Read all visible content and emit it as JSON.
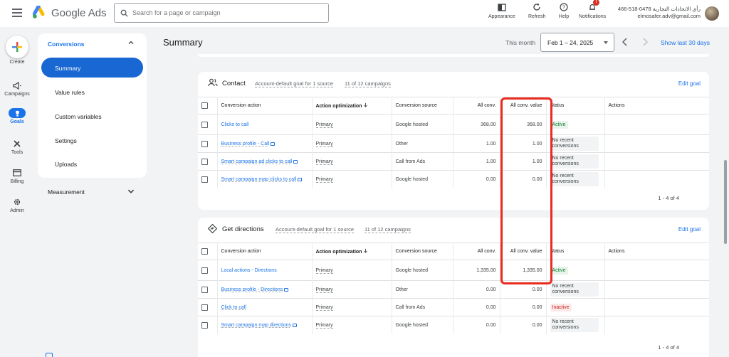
{
  "app": {
    "brand": "Google Ads",
    "search_placeholder": "Search for a page or campaign",
    "actions": [
      {
        "label": "Appearance",
        "icon": "appearance-icon"
      },
      {
        "label": "Refresh",
        "icon": "refresh-icon"
      },
      {
        "label": "Help",
        "icon": "help-icon"
      },
      {
        "label": "Notifications",
        "icon": "bell-icon",
        "badge": "!"
      }
    ],
    "account": {
      "name": "466-518-0478 رأي الاتحادات التجارية",
      "email": "elmosafer.adv@gmail.com"
    }
  },
  "rail": {
    "items": [
      {
        "label": "Create",
        "icon": "plus-icon"
      },
      {
        "label": "Campaigns",
        "icon": "megaphone-icon"
      },
      {
        "label": "Goals",
        "icon": "trophy-icon",
        "active": true
      },
      {
        "label": "Tools",
        "icon": "tools-icon"
      },
      {
        "label": "Billing",
        "icon": "card-icon"
      },
      {
        "label": "Admin",
        "icon": "gear-icon"
      }
    ]
  },
  "subnav": {
    "header": "Conversions",
    "items": [
      "Summary",
      "Value rules",
      "Custom variables",
      "Settings",
      "Uploads"
    ],
    "active": "Summary",
    "measurement": "Measurement"
  },
  "page": {
    "title": "Summary",
    "this_month": "This month",
    "date_range": "Feb 1 – 24, 2025",
    "show_last": "Show last 30 days"
  },
  "columns": [
    "Conversion action",
    "Action optimization",
    "Conversion source",
    "All conv.",
    "All conv. value",
    "Status",
    "Actions"
  ],
  "goals": [
    {
      "title": "Contact",
      "icon": "contact-icon",
      "goal_type": "Account-default goal for 1 source",
      "campaigns": "11 of 12 campaigns",
      "edit": "Edit goal",
      "pager": "1 - 4 of 4",
      "rows": [
        {
          "action": "Clicks to call",
          "opt": "Primary",
          "source": "Google hosted",
          "conv": "368.00",
          "value": "368.00",
          "status": "Active",
          "status_type": "active",
          "lock": false
        },
        {
          "action": "Business profile - Call",
          "opt": "Primary",
          "source": "Other",
          "conv": "1.00",
          "value": "1.00",
          "status": "No recent conversions",
          "status_type": "none",
          "lock": true
        },
        {
          "action": "Smart campaign ad clicks to call",
          "opt": "Primary",
          "source": "Call from Ads",
          "conv": "1.00",
          "value": "1.00",
          "status": "No recent conversions",
          "status_type": "none",
          "lock": true
        },
        {
          "action": "Smart campaign map clicks to call",
          "opt": "Primary",
          "source": "Google hosted",
          "conv": "0.00",
          "value": "0.00",
          "status": "No recent conversions",
          "status_type": "none",
          "lock": true
        }
      ]
    },
    {
      "title": "Get directions",
      "icon": "directions-icon",
      "goal_type": "Account-default goal for 1 source",
      "campaigns": "11 of 12 campaigns",
      "edit": "Edit goal",
      "pager": "1 - 4 of 4",
      "rows": [
        {
          "action": "Local actions - Directions",
          "opt": "Primary",
          "source": "Google hosted",
          "conv": "1,335.00",
          "value": "1,335.00",
          "status": "Active",
          "status_type": "active",
          "lock": false
        },
        {
          "action": "Business profile - Directions",
          "opt": "Primary",
          "source": "Other",
          "conv": "0.00",
          "value": "0.00",
          "status": "No recent conversions",
          "status_type": "none",
          "lock": true
        },
        {
          "action": "Click to call",
          "opt": "Primary",
          "source": "Call from Ads",
          "conv": "0.00",
          "value": "0.00",
          "status": "Inactive",
          "status_type": "inactive",
          "lock": false
        },
        {
          "action": "Smart campaign map directions",
          "opt": "Primary",
          "source": "Google hosted",
          "conv": "0.00",
          "value": "0.00",
          "status": "No recent conversions",
          "status_type": "none",
          "lock": true
        }
      ]
    }
  ],
  "colors": {
    "accent": "#1a73e8",
    "nav_active": "#1967d2",
    "highlight": "#ea2b1f",
    "active_bg": "#e6f4ea",
    "inactive_bg": "#fce8e6"
  }
}
